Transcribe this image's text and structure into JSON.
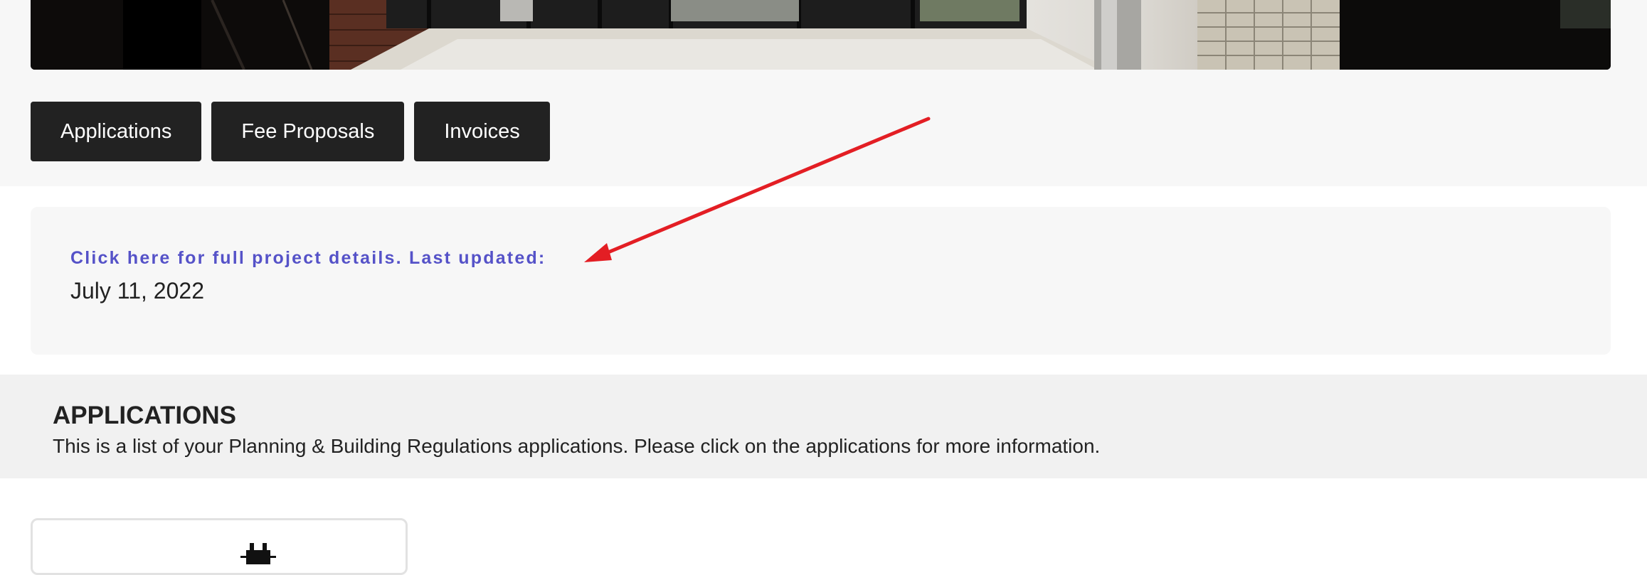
{
  "tabs": {
    "applications": "Applications",
    "fee_proposals": "Fee Proposals",
    "invoices": "Invoices"
  },
  "project_details": {
    "link_text": "Click here for full project details. Last updated:",
    "last_updated": "July 11, 2022"
  },
  "applications_section": {
    "title": "APPLICATIONS",
    "description": "This is a list of your Planning & Building Regulations applications. Please click on the applications for more information."
  },
  "icons": {
    "application_card": "building-icon"
  },
  "colors": {
    "button_bg": "#222222",
    "link": "#5552c8",
    "annotation_arrow": "#e31e24"
  }
}
